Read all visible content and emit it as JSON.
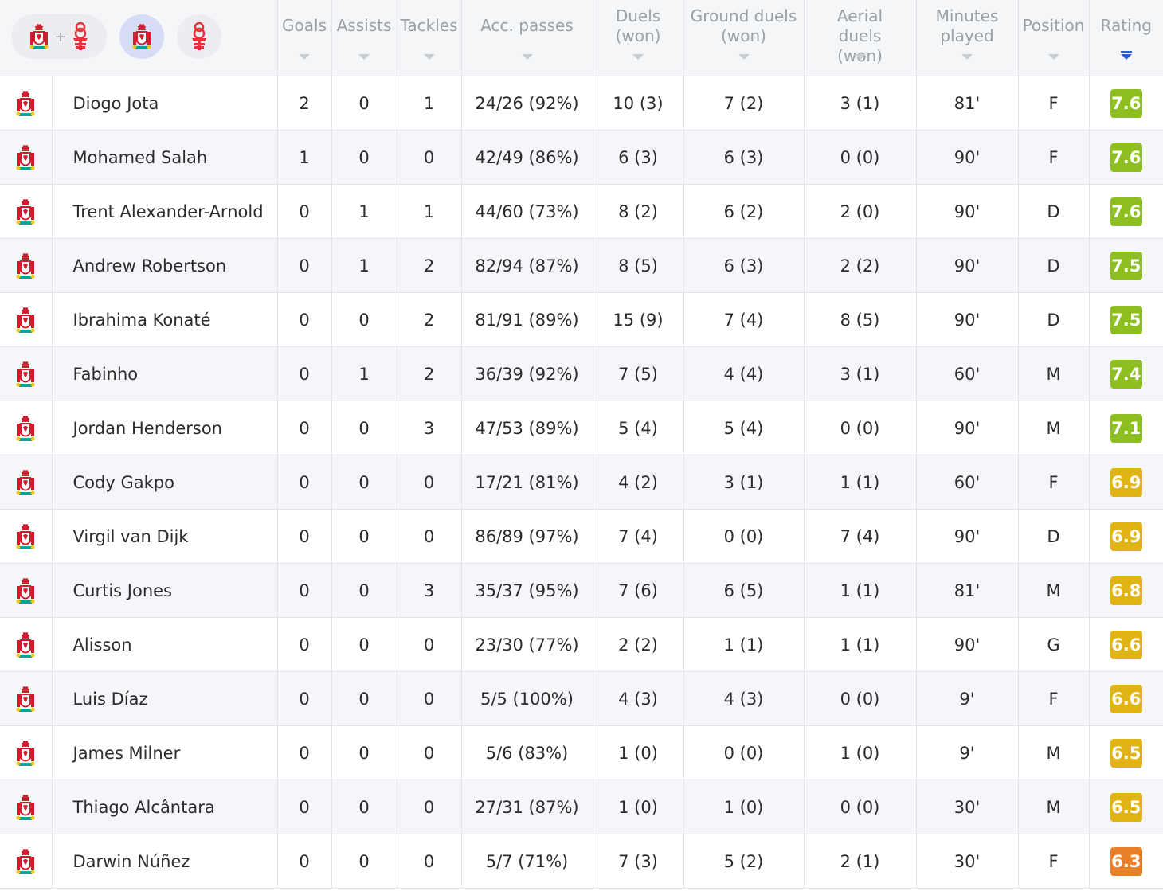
{
  "colors": {
    "rating_green": "#8cbf1f",
    "rating_gold": "#e0b414",
    "rating_orange": "#e8802a",
    "sort_active": "#2f5bd8",
    "liverpool_red": "#d11f2f",
    "forest_red": "#e53238"
  },
  "team_filter": {
    "combined_icons": [
      "liverpool-crest-icon",
      "forest-crest-icon"
    ],
    "separator": "+",
    "options": [
      "liverpool-crest-icon",
      "forest-crest-icon"
    ],
    "selected": "liverpool-crest-icon"
  },
  "columns": {
    "goals": "Goals",
    "assists": "Assists",
    "tackles": "Tackles",
    "acc_passes": "Acc. passes",
    "duels": "Duels (won)",
    "ground_duels": "Ground duels (won)",
    "aerial_duels": "Aerial duels (won)",
    "minutes": "Minutes played",
    "position": "Position",
    "rating": "Rating"
  },
  "sort": {
    "column": "rating",
    "direction": "descending"
  },
  "players": [
    {
      "name": "Diogo Jota",
      "goals": "2",
      "assists": "0",
      "tackles": "1",
      "passes": "24/26 (92%)",
      "duels": "10 (3)",
      "ground": "7 (2)",
      "aerial": "3 (1)",
      "minutes": "81'",
      "position": "F",
      "rating": "7.6",
      "rating_color": "#8cbf1f"
    },
    {
      "name": "Mohamed Salah",
      "goals": "1",
      "assists": "0",
      "tackles": "0",
      "passes": "42/49 (86%)",
      "duels": "6 (3)",
      "ground": "6 (3)",
      "aerial": "0 (0)",
      "minutes": "90'",
      "position": "F",
      "rating": "7.6",
      "rating_color": "#8cbf1f"
    },
    {
      "name": "Trent Alexander-Arnold",
      "goals": "0",
      "assists": "1",
      "tackles": "1",
      "passes": "44/60 (73%)",
      "duels": "8 (2)",
      "ground": "6 (2)",
      "aerial": "2 (0)",
      "minutes": "90'",
      "position": "D",
      "rating": "7.6",
      "rating_color": "#8cbf1f"
    },
    {
      "name": "Andrew Robertson",
      "goals": "0",
      "assists": "1",
      "tackles": "2",
      "passes": "82/94 (87%)",
      "duels": "8 (5)",
      "ground": "6 (3)",
      "aerial": "2 (2)",
      "minutes": "90'",
      "position": "D",
      "rating": "7.5",
      "rating_color": "#8cbf1f"
    },
    {
      "name": "Ibrahima Konaté",
      "goals": "0",
      "assists": "0",
      "tackles": "2",
      "passes": "81/91 (89%)",
      "duels": "15 (9)",
      "ground": "7 (4)",
      "aerial": "8 (5)",
      "minutes": "90'",
      "position": "D",
      "rating": "7.5",
      "rating_color": "#8cbf1f"
    },
    {
      "name": "Fabinho",
      "goals": "0",
      "assists": "1",
      "tackles": "2",
      "passes": "36/39 (92%)",
      "duels": "7 (5)",
      "ground": "4 (4)",
      "aerial": "3 (1)",
      "minutes": "60'",
      "position": "M",
      "rating": "7.4",
      "rating_color": "#8cbf1f"
    },
    {
      "name": "Jordan Henderson",
      "goals": "0",
      "assists": "0",
      "tackles": "3",
      "passes": "47/53 (89%)",
      "duels": "5 (4)",
      "ground": "5 (4)",
      "aerial": "0 (0)",
      "minutes": "90'",
      "position": "M",
      "rating": "7.1",
      "rating_color": "#8cbf1f"
    },
    {
      "name": "Cody Gakpo",
      "goals": "0",
      "assists": "0",
      "tackles": "0",
      "passes": "17/21 (81%)",
      "duels": "4 (2)",
      "ground": "3 (1)",
      "aerial": "1 (1)",
      "minutes": "60'",
      "position": "F",
      "rating": "6.9",
      "rating_color": "#e0b414"
    },
    {
      "name": "Virgil van Dijk",
      "goals": "0",
      "assists": "0",
      "tackles": "0",
      "passes": "86/89 (97%)",
      "duels": "7 (4)",
      "ground": "0 (0)",
      "aerial": "7 (4)",
      "minutes": "90'",
      "position": "D",
      "rating": "6.9",
      "rating_color": "#e0b414"
    },
    {
      "name": "Curtis Jones",
      "goals": "0",
      "assists": "0",
      "tackles": "3",
      "passes": "35/37 (95%)",
      "duels": "7 (6)",
      "ground": "6 (5)",
      "aerial": "1 (1)",
      "minutes": "81'",
      "position": "M",
      "rating": "6.8",
      "rating_color": "#e0b414"
    },
    {
      "name": "Alisson",
      "goals": "0",
      "assists": "0",
      "tackles": "0",
      "passes": "23/30 (77%)",
      "duels": "2 (2)",
      "ground": "1 (1)",
      "aerial": "1 (1)",
      "minutes": "90'",
      "position": "G",
      "rating": "6.6",
      "rating_color": "#e0b414"
    },
    {
      "name": "Luis Díaz",
      "goals": "0",
      "assists": "0",
      "tackles": "0",
      "passes": "5/5 (100%)",
      "duels": "4 (3)",
      "ground": "4 (3)",
      "aerial": "0 (0)",
      "minutes": "9'",
      "position": "F",
      "rating": "6.6",
      "rating_color": "#e0b414"
    },
    {
      "name": "James Milner",
      "goals": "0",
      "assists": "0",
      "tackles": "0",
      "passes": "5/6 (83%)",
      "duels": "1 (0)",
      "ground": "0 (0)",
      "aerial": "1 (0)",
      "minutes": "9'",
      "position": "M",
      "rating": "6.5",
      "rating_color": "#e0b414"
    },
    {
      "name": "Thiago Alcântara",
      "goals": "0",
      "assists": "0",
      "tackles": "0",
      "passes": "27/31 (87%)",
      "duels": "1 (0)",
      "ground": "1 (0)",
      "aerial": "0 (0)",
      "minutes": "30'",
      "position": "M",
      "rating": "6.5",
      "rating_color": "#e0b414"
    },
    {
      "name": "Darwin Núñez",
      "goals": "0",
      "assists": "0",
      "tackles": "0",
      "passes": "5/7 (71%)",
      "duels": "7 (3)",
      "ground": "5 (2)",
      "aerial": "2 (1)",
      "minutes": "30'",
      "position": "F",
      "rating": "6.3",
      "rating_color": "#e8802a"
    }
  ]
}
